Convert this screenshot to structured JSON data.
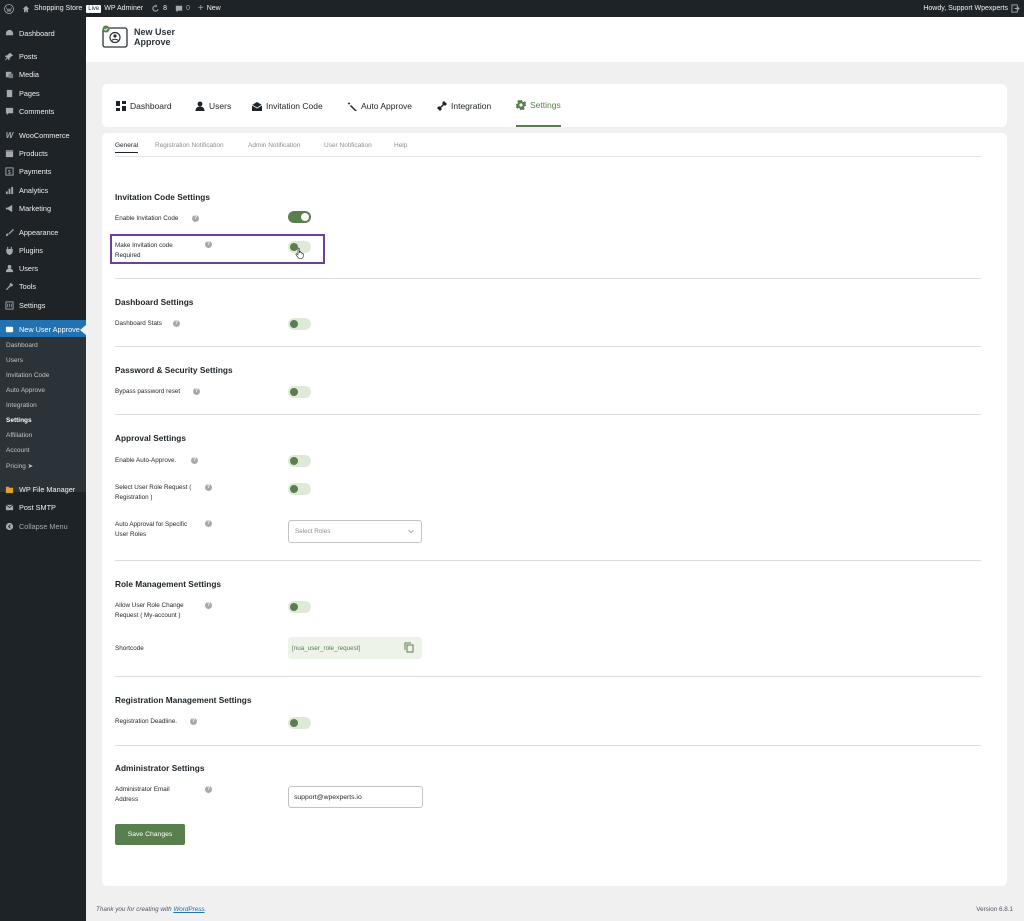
{
  "adminbar": {
    "site_name": "Shopping Store",
    "live_badge": "Live",
    "admin_name": "WP Adminer",
    "updates_count": "8",
    "comments_count": "0",
    "new_label": "New",
    "howdy": "Howdy, Support Wpexperts"
  },
  "sidebar": {
    "items": [
      {
        "label": "Dashboard"
      },
      {
        "label": "Posts"
      },
      {
        "label": "Media"
      },
      {
        "label": "Pages"
      },
      {
        "label": "Comments"
      },
      {
        "label": "WooCommerce"
      },
      {
        "label": "Products"
      },
      {
        "label": "Payments"
      },
      {
        "label": "Analytics"
      },
      {
        "label": "Marketing"
      },
      {
        "label": "Appearance"
      },
      {
        "label": "Plugins"
      },
      {
        "label": "Users"
      },
      {
        "label": "Tools"
      },
      {
        "label": "Settings"
      },
      {
        "label": "New User Approve"
      },
      {
        "label": "WP File Manager"
      },
      {
        "label": "Post SMTP"
      },
      {
        "label": "Collapse Menu"
      }
    ],
    "submenu": [
      "Dashboard",
      "Users",
      "Invitation Code",
      "Auto Approve",
      "Integration",
      "Settings",
      "Affiliation",
      "Account",
      "Pricing ➤"
    ]
  },
  "header": {
    "logo_line1": "New User",
    "logo_line2": "Approve"
  },
  "nav": {
    "tabs": [
      "Dashboard",
      "Users",
      "Invitation Code",
      "Auto Approve",
      "Integration",
      "Settings"
    ],
    "active": "Settings"
  },
  "subtabs": [
    "General",
    "Registration Notification",
    "Admin Notification",
    "User Notification",
    "Help"
  ],
  "sections": {
    "invitation": {
      "title": "Invitation Code Settings",
      "enable_label": "Enable Invitation Code",
      "enable_on": true,
      "required_label_1": "Make Invitation code",
      "required_label_2": "Required",
      "required_on": false
    },
    "dashboard": {
      "title": "Dashboard Settings",
      "stats_label": "Dashboard Stats",
      "stats_on": false
    },
    "password": {
      "title": "Password & Security Settings",
      "bypass_label": "Bypass password reset",
      "bypass_on": false
    },
    "approval": {
      "title": "Approval Settings",
      "auto_label": "Enable Auto-Approve.",
      "role_req_label_1": "Select User Role Request (",
      "role_req_label_2": "Registration )",
      "specific_label_1": "Auto Approval for Specific",
      "specific_label_2": "User Roles",
      "roles_placeholder": "Select Roles"
    },
    "role": {
      "title": "Role Management Settings",
      "change_label_1": "Allow User Role Change",
      "change_label_2": "Request ( My-account )",
      "shortcode_label": "Shortcode",
      "shortcode_value": "[nua_user_role_request]"
    },
    "registration": {
      "title": "Registration Management Settings",
      "deadline_label": "Registration Deadline."
    },
    "admin": {
      "title": "Administrator Settings",
      "email_label_1": "Administrator Email",
      "email_label_2": "Address",
      "email_value": "support@wpexperts.io"
    }
  },
  "save_button": "Save Changes",
  "footer": {
    "text": "Thank you for creating with ",
    "link": "WordPress",
    "suffix": ".",
    "version": "Version 6.8.1"
  },
  "colors": {
    "accent": "#5a7f4f",
    "highlight": "#6b3fa0",
    "wp_blue": "#2271b1",
    "admin_dark": "#1d2327"
  }
}
